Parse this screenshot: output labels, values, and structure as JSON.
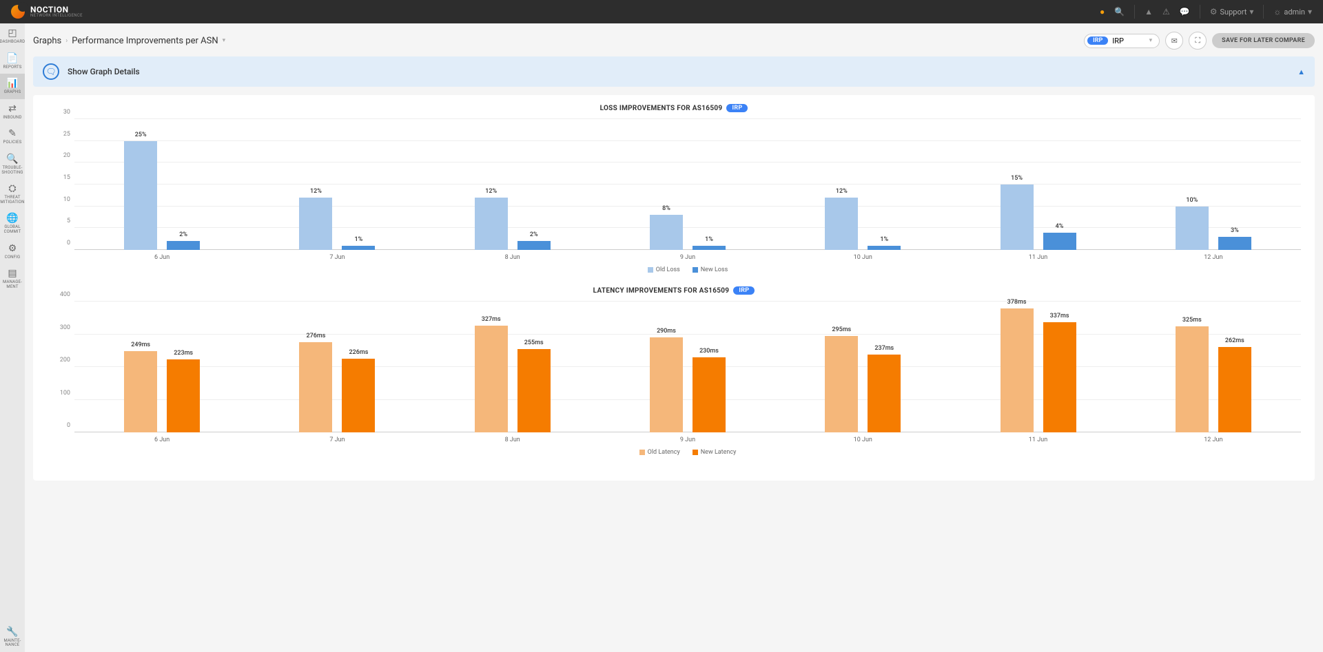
{
  "logo": {
    "main": "NOCTION",
    "sub": "NETWORK INTELLIGENCE"
  },
  "header": {
    "support": "Support",
    "user": "admin"
  },
  "sidebar": {
    "items": [
      {
        "label": "DASHBOARD"
      },
      {
        "label": "REPORTS"
      },
      {
        "label": "GRAPHS"
      },
      {
        "label": "INBOUND"
      },
      {
        "label": "POLICIES"
      },
      {
        "label": "TROUBLE-\nSHOOTING"
      },
      {
        "label": "THREAT\nMITIGATION"
      },
      {
        "label": "GLOBAL\nCOMMIT"
      },
      {
        "label": "CONFIG"
      },
      {
        "label": "MANAGE-\nMENT"
      }
    ],
    "bottom": {
      "label": "MAINTE-\nNANCE"
    }
  },
  "breadcrumb": {
    "root": "Graphs",
    "page": "Performance Improvements per ASN"
  },
  "irp_select": {
    "pill": "IRP",
    "value": "IRP"
  },
  "save_btn": "SAVE FOR LATER COMPARE",
  "banner": {
    "text": "Show Graph Details"
  },
  "chart_data": [
    {
      "type": "bar",
      "title": "LOSS IMPROVEMENTS FOR AS16509",
      "pill": "IRP",
      "categories": [
        "6 Jun",
        "7 Jun",
        "8 Jun",
        "9 Jun",
        "10 Jun",
        "11 Jun",
        "12 Jun"
      ],
      "series": [
        {
          "name": "Old Loss",
          "color": "c-oldloss",
          "values": [
            25,
            12,
            12,
            8,
            12,
            15,
            10
          ],
          "labels": [
            "25%",
            "12%",
            "12%",
            "8%",
            "12%",
            "15%",
            "10%"
          ]
        },
        {
          "name": "New Loss",
          "color": "c-newloss",
          "values": [
            2,
            1,
            2,
            1,
            1,
            4,
            3
          ],
          "labels": [
            "2%",
            "1%",
            "2%",
            "1%",
            "1%",
            "4%",
            "3%"
          ]
        }
      ],
      "ylim": [
        0,
        30
      ],
      "yticks": [
        0,
        5,
        10,
        15,
        20,
        25,
        30
      ],
      "height": 190
    },
    {
      "type": "bar",
      "title": "LATENCY IMPROVEMENTS FOR AS16509",
      "pill": "IRP",
      "categories": [
        "6 Jun",
        "7 Jun",
        "8 Jun",
        "9 Jun",
        "10 Jun",
        "11 Jun",
        "12 Jun"
      ],
      "series": [
        {
          "name": "Old Latency",
          "color": "c-oldlat",
          "values": [
            249,
            276,
            327,
            290,
            295,
            378,
            325
          ],
          "labels": [
            "249ms",
            "276ms",
            "327ms",
            "290ms",
            "295ms",
            "378ms",
            "325ms"
          ]
        },
        {
          "name": "New Latency",
          "color": "c-newlat",
          "values": [
            223,
            226,
            255,
            230,
            237,
            337,
            262
          ],
          "labels": [
            "223ms",
            "226ms",
            "255ms",
            "230ms",
            "237ms",
            "337ms",
            "262ms"
          ]
        }
      ],
      "ylim": [
        0,
        400
      ],
      "yticks": [
        0,
        100,
        200,
        300,
        400
      ],
      "height": 190
    }
  ]
}
